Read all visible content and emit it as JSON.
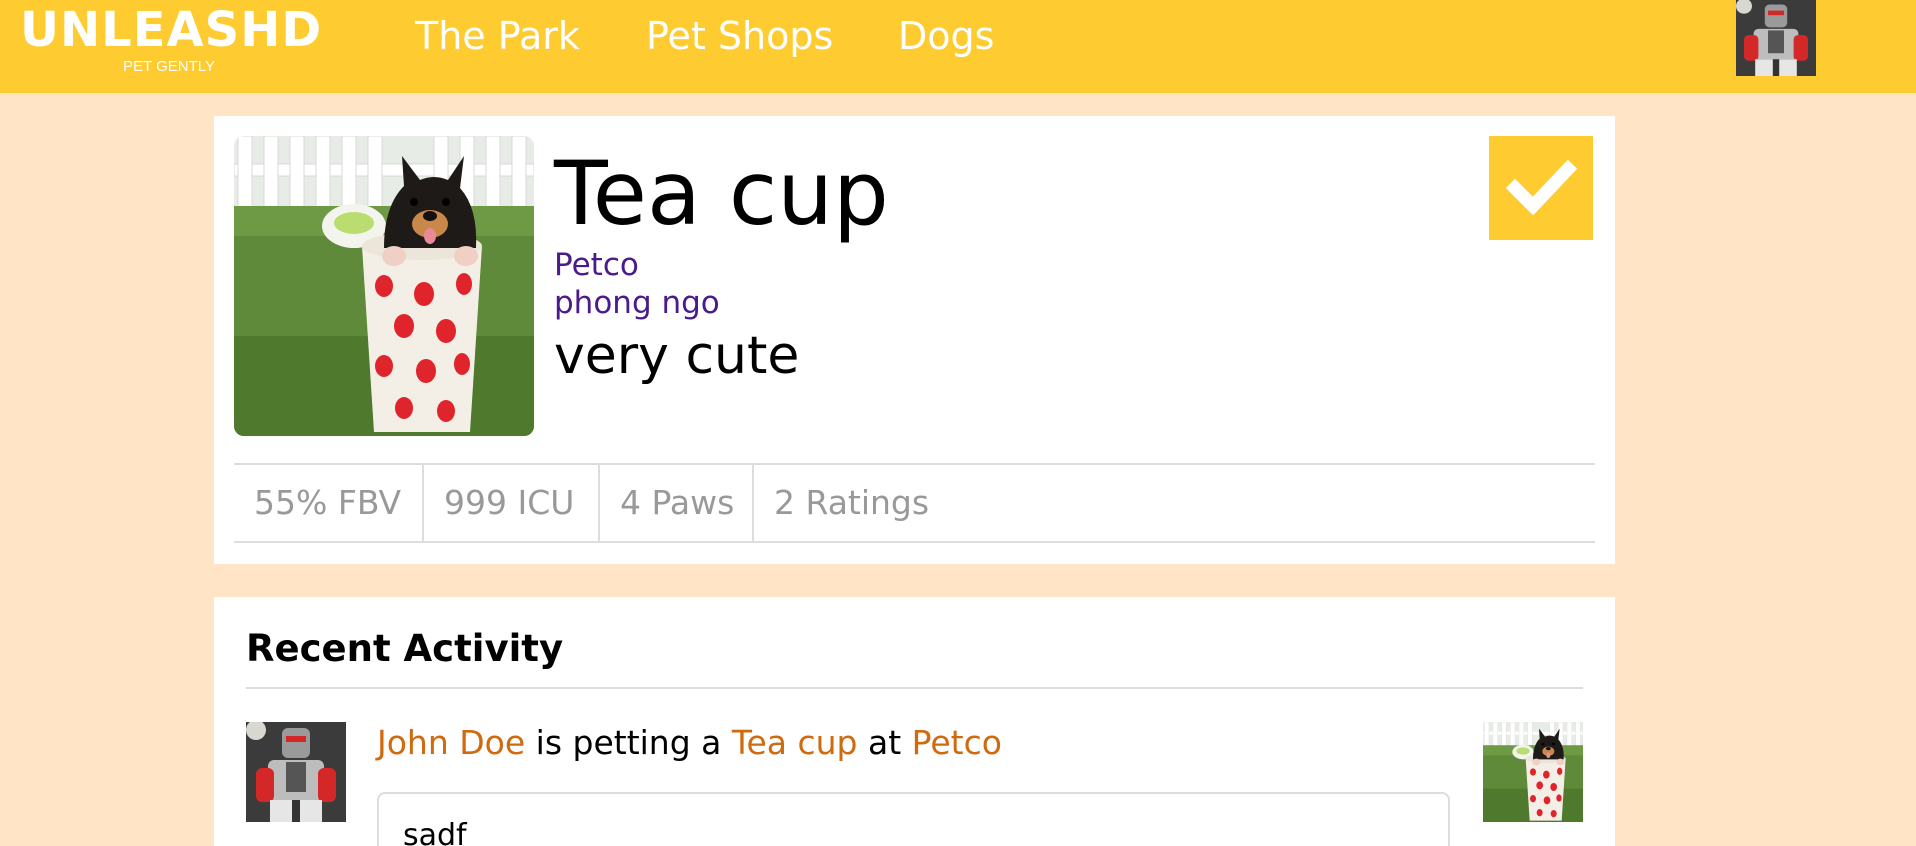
{
  "nav": {
    "brand": "UNLEASHD",
    "tagline": "PET GENTLY",
    "links": [
      "The Park",
      "Pet Shops",
      "Dogs"
    ]
  },
  "pet": {
    "name": "Tea cup",
    "shop": "Petco",
    "owner": "phong ngo",
    "description": "very cute",
    "stats": [
      "55% FBV",
      "999 ICU",
      "4 Paws",
      "2 Ratings"
    ]
  },
  "activity": {
    "heading": "Recent Activity",
    "items": [
      {
        "user": "John Doe",
        "verb_1": "is petting a",
        "pet": "Tea cup",
        "verb_2": "at",
        "place": "Petco",
        "comment": "sadf"
      }
    ]
  },
  "colors": {
    "nav_yellow": "#fecc30",
    "page_bg": "#ffe4c6",
    "link_purple": "#4b1b8c",
    "link_orange": "#d06a0e",
    "stat_gray": "#999999"
  },
  "icons": [
    "checkmark-icon"
  ]
}
